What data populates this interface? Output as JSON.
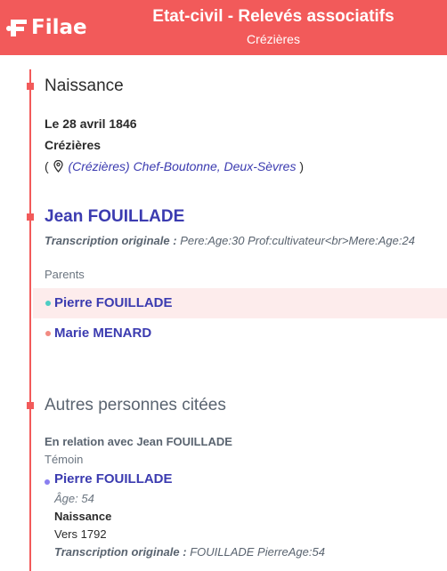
{
  "header": {
    "logo_text": "Filae",
    "title": "Etat-civil - Relevés associatifs",
    "subtitle": "Crézières"
  },
  "colors": {
    "brand": "#f25a5a",
    "link": "#3b3bb0",
    "father_dot": "#4ecdc4",
    "mother_dot": "#f28b82",
    "witness_dot": "#8a7ff0"
  },
  "naissance": {
    "title": "Naissance",
    "date": "Le 28 avril 1846",
    "place": "Crézières",
    "paren_open": "(",
    "place_link": "(Crézières) Chef-Boutonne, Deux-Sèvres",
    "paren_close": ")"
  },
  "person": {
    "name": "Jean FOUILLADE",
    "transcription_label": "Transcription originale :",
    "transcription_value": "Pere:Age:30 Prof:cultivateur<br>Mere:Age:24"
  },
  "parents": {
    "label": "Parents",
    "father": "Pierre FOUILLADE",
    "mother": "Marie MENARD"
  },
  "autres": {
    "title": "Autres personnes citées",
    "relation": "En relation avec Jean FOUILLADE",
    "role": "Témoin",
    "witness_name": "Pierre FOUILLADE",
    "age": "Âge: 54",
    "birth_label": "Naissance",
    "birth_value": "Vers 1792",
    "transcription_label": "Transcription originale :",
    "transcription_value": "FOUILLADE PierreAge:54"
  }
}
